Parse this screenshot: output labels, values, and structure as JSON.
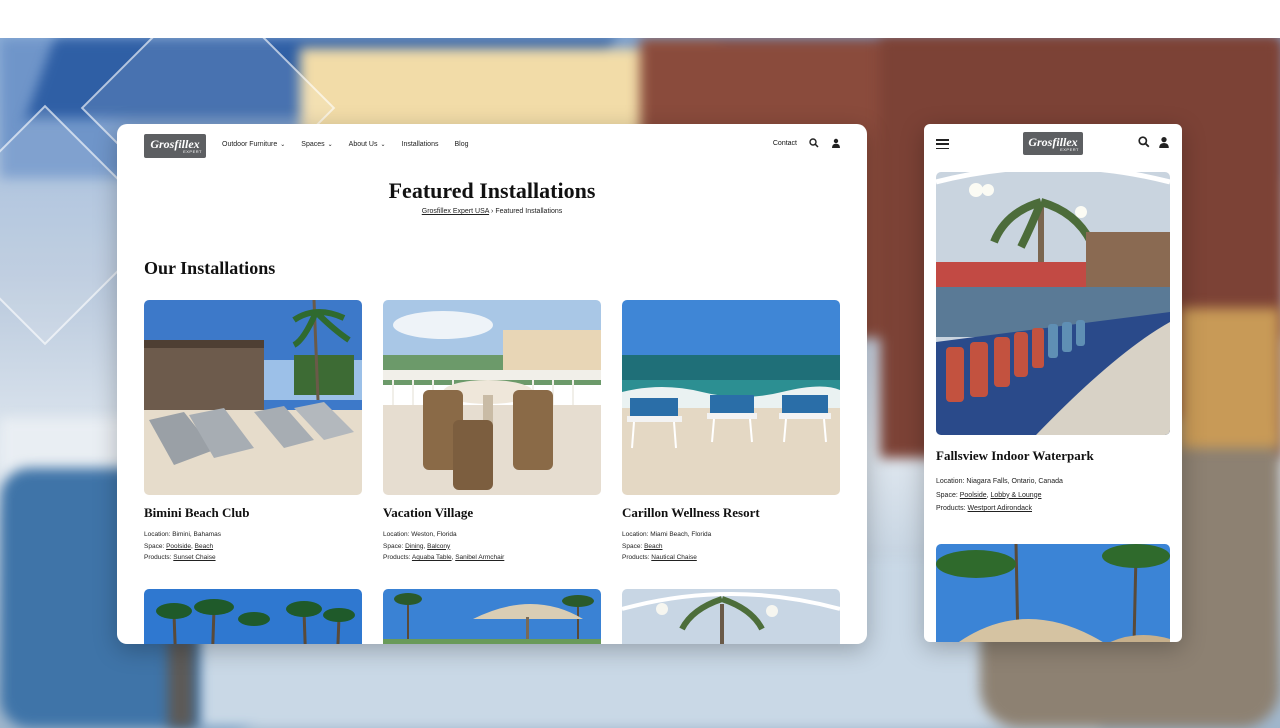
{
  "desktop": {
    "logo": {
      "word": "Grosfillex",
      "sub": "EXPERT"
    },
    "menu": [
      {
        "label": "Outdoor Furniture",
        "dropdown": true
      },
      {
        "label": "Spaces",
        "dropdown": true
      },
      {
        "label": "About Us",
        "dropdown": true
      },
      {
        "label": "Installations",
        "dropdown": false
      },
      {
        "label": "Blog",
        "dropdown": false
      }
    ],
    "contact_label": "Contact",
    "page_title": "Featured Installations",
    "breadcrumb": {
      "home": "Grosfillex Expert USA",
      "separator": "›",
      "current": "Featured Installations"
    },
    "section_title": "Our Installations",
    "cards": [
      {
        "name": "Bimini Beach Club",
        "location_label": "Location:",
        "location": "Bimini, Bahamas",
        "space_label": "Space:",
        "spaces": [
          "Poolside",
          "Beach"
        ],
        "products_label": "Products:",
        "products": [
          "Sunset Chaise"
        ]
      },
      {
        "name": "Vacation Village",
        "location_label": "Location:",
        "location": "Weston, Florida",
        "space_label": "Space:",
        "spaces": [
          "Dining",
          "Balcony"
        ],
        "products_label": "Products:",
        "products": [
          "Aquaba Table",
          "Sanibel Armchair"
        ]
      },
      {
        "name": "Carillon Wellness Resort",
        "location_label": "Location:",
        "location": "Miami Beach, Florida",
        "space_label": "Space:",
        "spaces": [
          "Beach"
        ],
        "products_label": "Products:",
        "products": [
          "Nautical Chaise"
        ]
      }
    ]
  },
  "mobile": {
    "logo": {
      "word": "Grosfillex",
      "sub": "EXPERT"
    },
    "card": {
      "name": "Fallsview Indoor Waterpark",
      "location_label": "Location:",
      "location": "Niagara Falls, Ontario, Canada",
      "space_label": "Space:",
      "spaces": [
        "Poolside",
        "Lobby & Lounge"
      ],
      "products_label": "Products:",
      "products": [
        "Westport Adirondack"
      ]
    }
  },
  "icons": {
    "search": "search-icon",
    "user": "user-icon",
    "menu": "hamburger-menu-icon",
    "dropdown": "chevron-down-icon"
  },
  "colors": {
    "logo_bg": "#5d5f62",
    "text": "#111111",
    "card_bg": "#ffffff"
  }
}
